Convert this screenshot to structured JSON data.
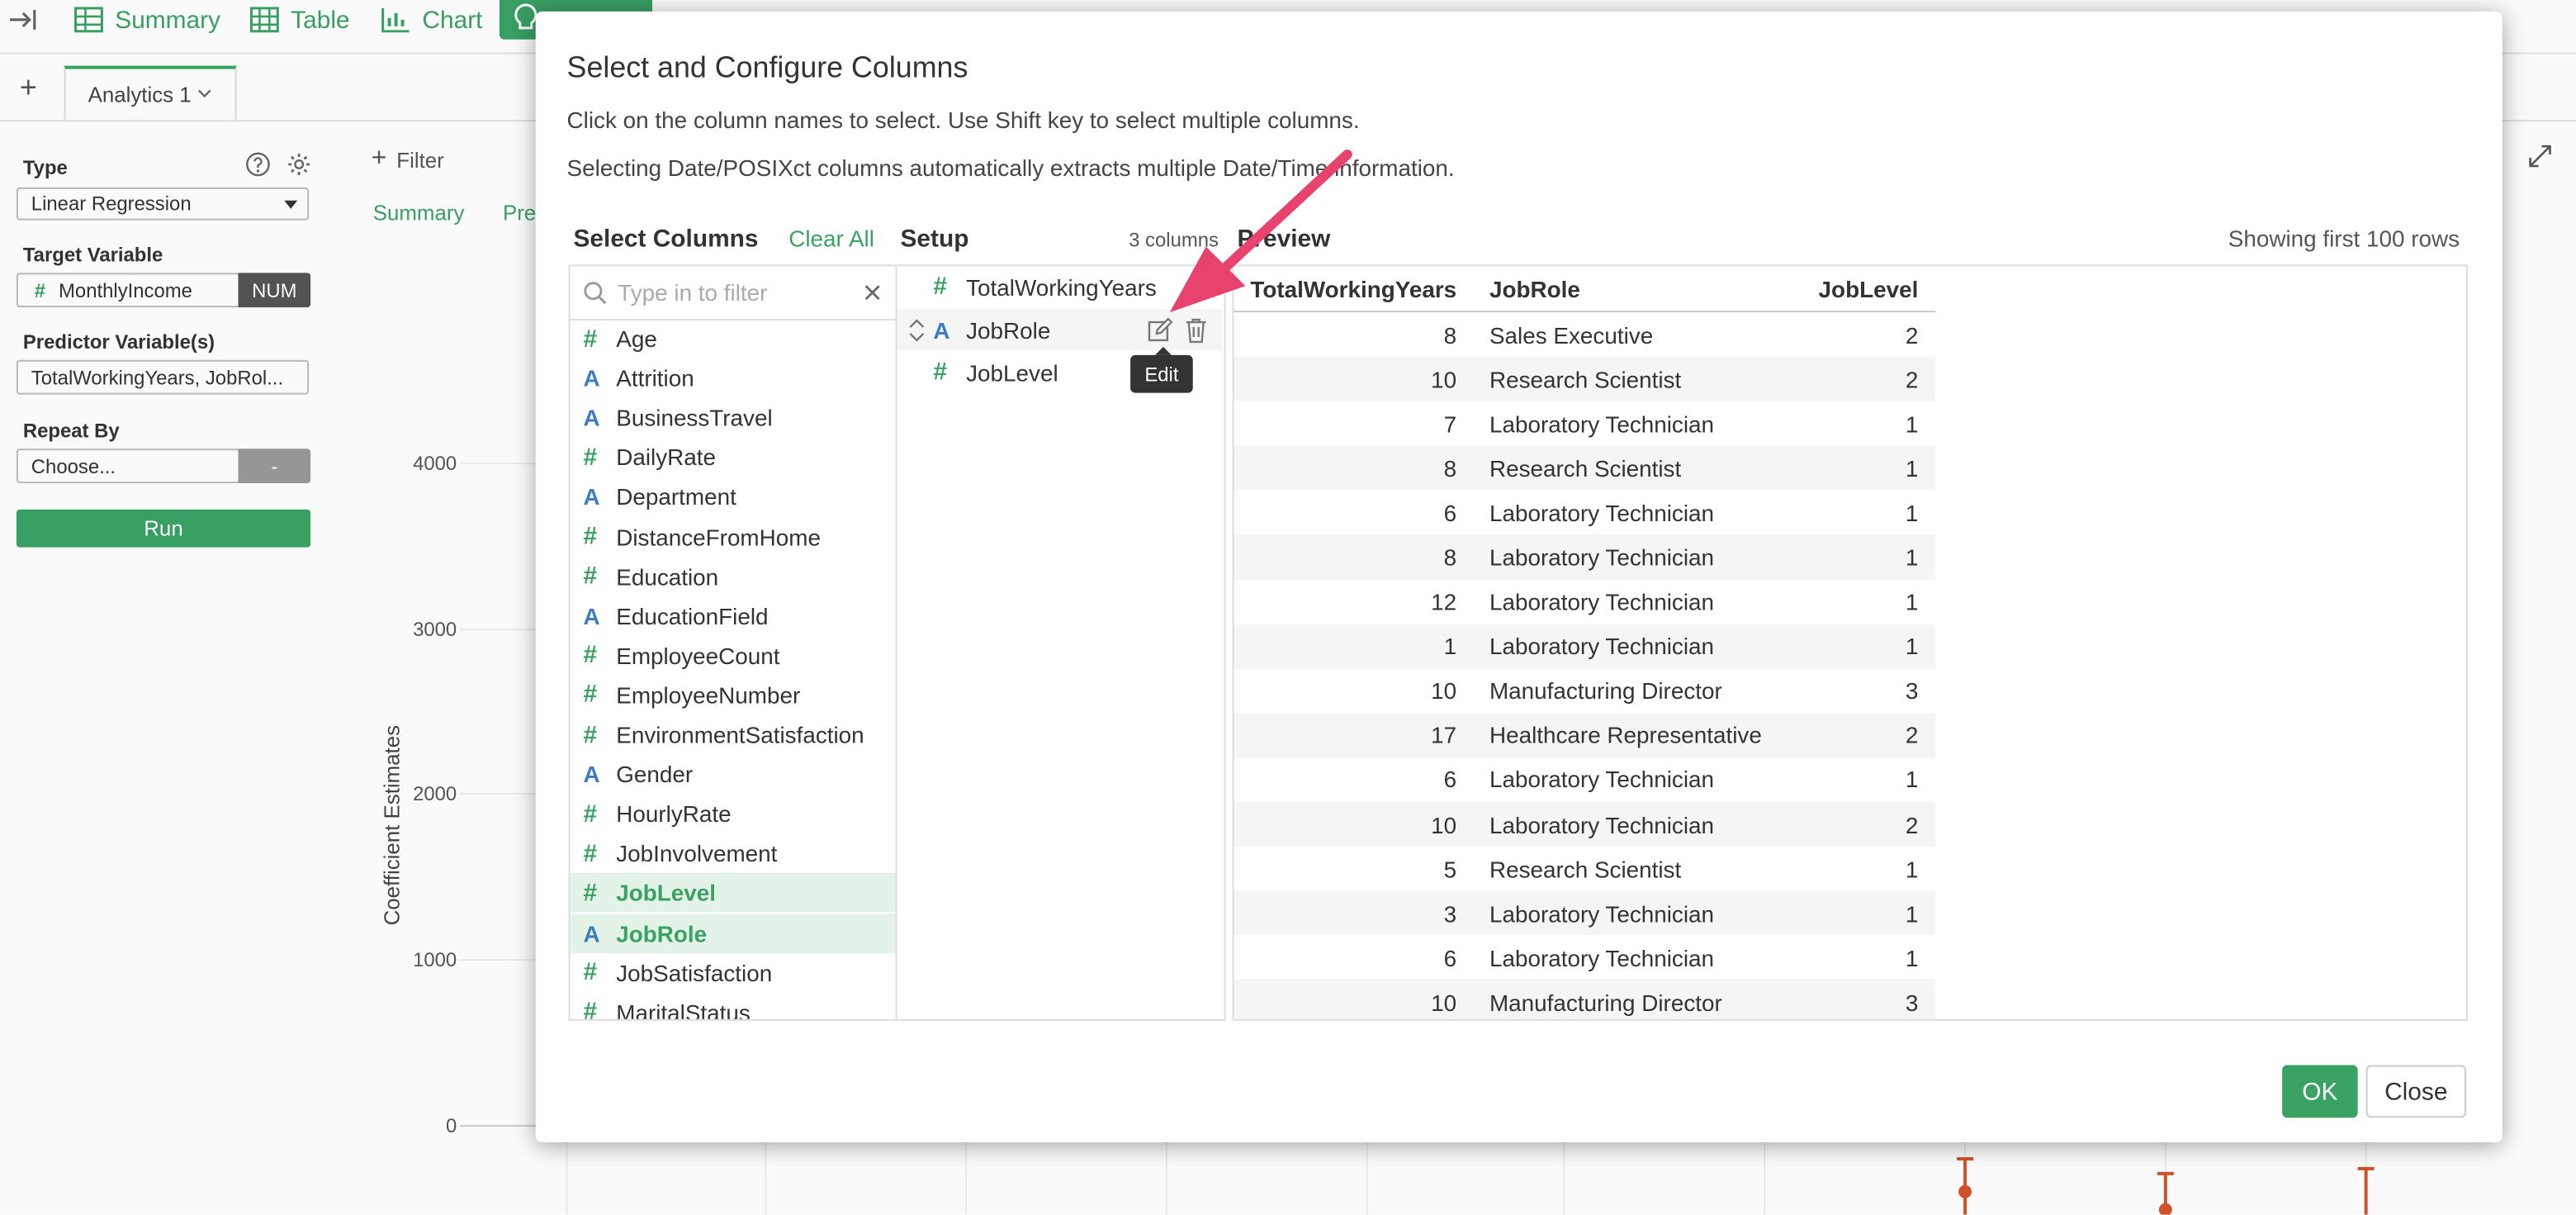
{
  "toolbar": {
    "summary_label": "Summary",
    "table_label": "Table",
    "chart_label": "Chart"
  },
  "tabs": {
    "active_label": "Analytics 1"
  },
  "left_panel": {
    "type_label": "Type",
    "type_value": "Linear Regression",
    "target_label": "Target Variable",
    "target_value": "MonthlyIncome",
    "target_badge": "NUM",
    "predictor_label": "Predictor Variable(s)",
    "predictor_value": "TotalWorkingYears, JobRol...",
    "repeat_label": "Repeat By",
    "repeat_value": "Choose...",
    "repeat_badge": "-",
    "run_label": "Run"
  },
  "background": {
    "filter_label": "Filter",
    "tab_summary": "Summary",
    "tab_pre": "Pre",
    "y_axis_label": "Coefficient Estimates",
    "y_ticks": [
      "4000",
      "3000",
      "2000",
      "1000",
      "0"
    ]
  },
  "modal": {
    "title": "Select and Configure Columns",
    "desc1": "Click on the column names to select. Use Shift key to select multiple columns.",
    "desc2": "Selecting Date/POSIXct columns automatically extracts multiple Date/Time information.",
    "select_title": "Select Columns",
    "clear_all": "Clear All",
    "setup_title": "Setup",
    "column_count": "3 columns",
    "preview_title": "Preview",
    "showing": "Showing first 100 rows",
    "filter_placeholder": "Type in to filter",
    "columns": [
      {
        "type": "num",
        "name": "Age",
        "selected": false
      },
      {
        "type": "char",
        "name": "Attrition",
        "selected": false
      },
      {
        "type": "char",
        "name": "BusinessTravel",
        "selected": false
      },
      {
        "type": "num",
        "name": "DailyRate",
        "selected": false
      },
      {
        "type": "char",
        "name": "Department",
        "selected": false
      },
      {
        "type": "num",
        "name": "DistanceFromHome",
        "selected": false
      },
      {
        "type": "num",
        "name": "Education",
        "selected": false
      },
      {
        "type": "char",
        "name": "EducationField",
        "selected": false
      },
      {
        "type": "num",
        "name": "EmployeeCount",
        "selected": false
      },
      {
        "type": "num",
        "name": "EmployeeNumber",
        "selected": false
      },
      {
        "type": "num",
        "name": "EnvironmentSatisfaction",
        "selected": false
      },
      {
        "type": "char",
        "name": "Gender",
        "selected": false
      },
      {
        "type": "num",
        "name": "HourlyRate",
        "selected": false
      },
      {
        "type": "num",
        "name": "JobInvolvement",
        "selected": false
      },
      {
        "type": "num",
        "name": "JobLevel",
        "selected": true
      },
      {
        "type": "char",
        "name": "JobRole",
        "selected": true
      },
      {
        "type": "num",
        "name": "JobSatisfaction",
        "selected": false
      },
      {
        "type": "num",
        "name": "MaritalStatus",
        "selected": false
      }
    ],
    "setup_items": [
      {
        "type": "num",
        "name": "TotalWorkingYears"
      },
      {
        "type": "char",
        "name": "JobRole"
      },
      {
        "type": "num",
        "name": "JobLevel"
      }
    ],
    "tooltip": "Edit",
    "preview_headers": [
      "TotalWorkingYears",
      "JobRole",
      "JobLevel"
    ],
    "preview_rows": [
      [
        "8",
        "Sales Executive",
        "2"
      ],
      [
        "10",
        "Research Scientist",
        "2"
      ],
      [
        "7",
        "Laboratory Technician",
        "1"
      ],
      [
        "8",
        "Research Scientist",
        "1"
      ],
      [
        "6",
        "Laboratory Technician",
        "1"
      ],
      [
        "8",
        "Laboratory Technician",
        "1"
      ],
      [
        "12",
        "Laboratory Technician",
        "1"
      ],
      [
        "1",
        "Laboratory Technician",
        "1"
      ],
      [
        "10",
        "Manufacturing Director",
        "3"
      ],
      [
        "17",
        "Healthcare Representative",
        "2"
      ],
      [
        "6",
        "Laboratory Technician",
        "1"
      ],
      [
        "10",
        "Laboratory Technician",
        "2"
      ],
      [
        "5",
        "Research Scientist",
        "1"
      ],
      [
        "3",
        "Laboratory Technician",
        "1"
      ],
      [
        "6",
        "Laboratory Technician",
        "1"
      ],
      [
        "10",
        "Manufacturing Director",
        "3"
      ]
    ],
    "ok_label": "OK",
    "close_label": "Close"
  },
  "colors": {
    "accent": "#3aa364",
    "char_type": "#3b7dbf",
    "arrow": "#e8436e",
    "chart_bar": "#d4532a"
  }
}
